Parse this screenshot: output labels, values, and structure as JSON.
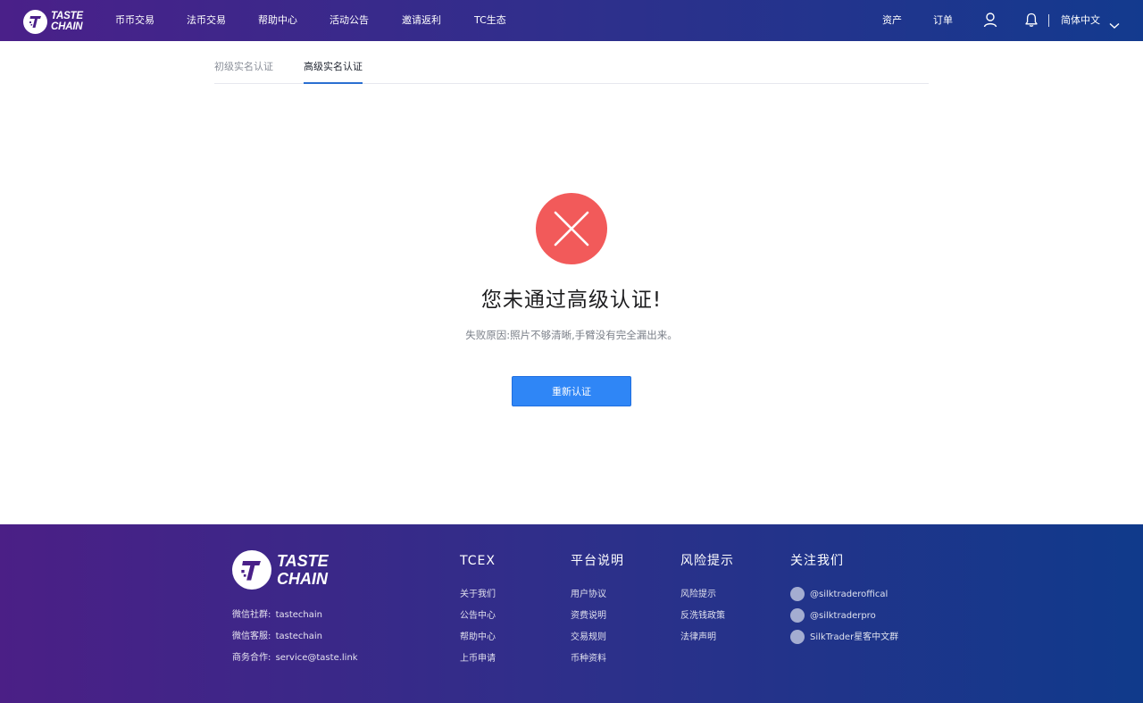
{
  "header": {
    "logo_line1": "TASTE",
    "logo_line2": "CHAIN",
    "nav": [
      "币币交易",
      "法币交易",
      "帮助中心",
      "活动公告",
      "邀请返利",
      "TC生态"
    ],
    "assets": "资产",
    "orders": "订单",
    "language": "简体中文"
  },
  "tabs": {
    "basic": "初级实名认证",
    "advanced": "高级实名认证"
  },
  "result": {
    "title": "您未通过高级认证!",
    "reason": "失败原因:照片不够清晰,手臂没有完全漏出来。",
    "retry_label": "重新认证"
  },
  "footer": {
    "logo_line1": "TASTE",
    "logo_line2": "CHAIN",
    "contacts": [
      {
        "label": "微信社群:",
        "value": "tastechain"
      },
      {
        "label": "微信客服:",
        "value": "tastechain"
      },
      {
        "label": "商务合作:",
        "value": "service@taste.link"
      }
    ],
    "columns": [
      {
        "title": "TCEX",
        "links": [
          "关于我们",
          "公告中心",
          "帮助中心",
          "上币申请"
        ]
      },
      {
        "title": "平台说明",
        "links": [
          "用户协议",
          "资费说明",
          "交易规则",
          "币种资料"
        ]
      },
      {
        "title": "风险提示",
        "links": [
          "风险提示",
          "反洗钱政策",
          "法律声明"
        ]
      }
    ],
    "follow": {
      "title": "关注我们",
      "accounts": [
        "@silktraderoffical",
        "@silktraderpro",
        "SilkTrader星客中文群"
      ]
    }
  },
  "colors": {
    "header_gradient": [
      "#4a2089",
      "#133a8e"
    ],
    "error_red": "#f25a5a",
    "primary_blue": "#2f86f6",
    "tab_active": "#2a6fd1"
  }
}
